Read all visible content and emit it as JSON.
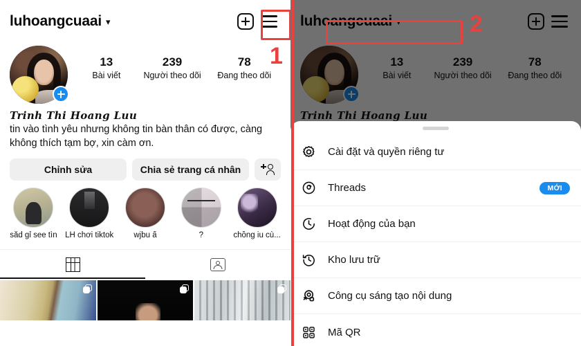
{
  "header": {
    "username": "luhoangcuaai",
    "chevron": "chevron-down-icon",
    "add_icon": "plus-square-icon",
    "menu_icon": "hamburger-menu-icon"
  },
  "profile": {
    "stats": [
      {
        "num": "13",
        "label": "Bài viết"
      },
      {
        "num": "239",
        "label": "Người theo dõi"
      },
      {
        "num": "78",
        "label": "Đang theo dõi"
      }
    ],
    "display_name": "Trinh Thi Hoang Luu",
    "bio": "tin vào tình yêu nhưng không tin bàn thân có được, càng không thích tạm bợ, xin càm ơn.",
    "avatar_badge": "add-story-plus-icon"
  },
  "actions": {
    "edit_label": "Chỉnh sửa",
    "share_label": "Chia sẻ trang cá nhân",
    "add_person_icon": "add-person-icon"
  },
  "highlights": [
    {
      "label": "săd gỉ see tìn"
    },
    {
      "label": "LH chơi tiktok"
    },
    {
      "label": "wjbu ấ"
    },
    {
      "label": "?"
    },
    {
      "label": "chồng iu cù..."
    }
  ],
  "tabs": [
    {
      "name": "grid-tab",
      "icon": "grid-icon",
      "active": true
    },
    {
      "name": "tagged-tab",
      "icon": "tagged-person-icon",
      "active": false
    }
  ],
  "menu": {
    "items": [
      {
        "label": "Cài đặt và quyền riêng tư",
        "icon": "gear-icon",
        "badge": ""
      },
      {
        "label": "Threads",
        "icon": "threads-at-icon",
        "badge": "MỚI"
      },
      {
        "label": "Hoạt động của bạn",
        "icon": "activity-clock-icon",
        "badge": ""
      },
      {
        "label": "Kho lưu trữ",
        "icon": "archive-clock-icon",
        "badge": ""
      },
      {
        "label": "Công cụ sáng tạo nội dung",
        "icon": "creator-tools-icon",
        "badge": ""
      },
      {
        "label": "Mã QR",
        "icon": "qr-code-icon",
        "badge": ""
      }
    ]
  },
  "annotations": [
    {
      "number": "1",
      "target": "hamburger-menu-icon"
    },
    {
      "number": "2",
      "target": "settings-and-privacy-row"
    }
  ],
  "colors": {
    "accent_red": "#e8413e",
    "badge_blue": "#1a8cf0",
    "button_grey": "#efefef"
  }
}
